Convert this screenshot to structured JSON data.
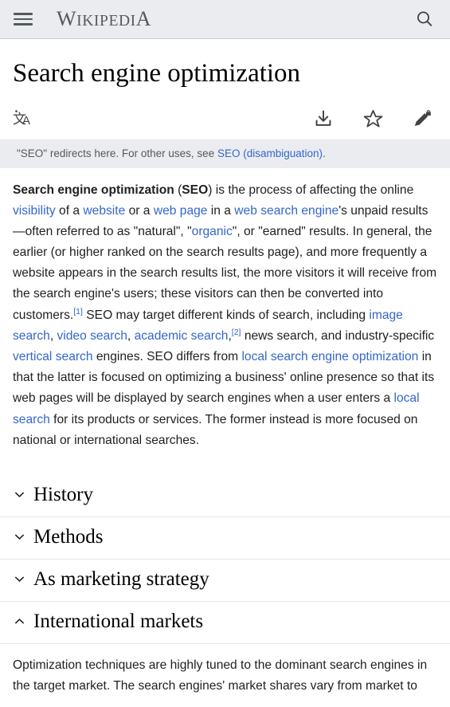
{
  "header": {
    "menu_label": "Menu",
    "wordmark": {
      "w": "W",
      "ikipedi": "IKIPEDI",
      "a": "A",
      "full": "WIKIPEDIA"
    },
    "search_label": "Search"
  },
  "article": {
    "title": "Search engine optimization",
    "hatnote": {
      "prefix": "\"SEO\" redirects here. For other uses, see ",
      "link": "SEO (disambiguation)",
      "suffix": "."
    }
  },
  "actions": {
    "language_icon_cjk": "文",
    "language_icon_latin": "A",
    "language_label": "Change language",
    "download_label": "Download",
    "watch_label": "Watch",
    "edit_label": "Edit protected page"
  },
  "lead": {
    "t1": "Search engine optimization",
    "t2": " (",
    "t3": "SEO",
    "t4": ") is the process of affecting the online ",
    "l1": "visibility",
    "t5": " of a ",
    "l2": "website",
    "t6": " or a ",
    "l3": "web page",
    "t7": " in a ",
    "l4": "web search engine",
    "t8": "'s unpaid results—often referred to as \"natural\", \"",
    "l5": "organic",
    "t9": "\", or \"earned\" results. In general, the earlier (or higher ranked on the search results page), and more frequently a website appears in the search results list, the more visitors it will receive from the search engine's users; these visitors can then be converted into customers.",
    "ref1": "[1]",
    "t10": " SEO may target different kinds of search, including ",
    "l6": "image search",
    "t11": ", ",
    "l7": "video search",
    "t12": ", ",
    "l8": "academic search",
    "t13": ",",
    "ref2": "[2]",
    "t14": " news search, and industry-specific ",
    "l9": "vertical search",
    "t15": " engines. SEO differs from ",
    "l10": "local search engine optimization",
    "t16": " in that the latter is focused on optimizing a business' online presence so that its web pages will be displayed by search engines when a user enters a ",
    "l11": "local search",
    "t17": " for its products or services. The former instead is more focused on national or international searches."
  },
  "sections": [
    {
      "title": "History",
      "expanded": false,
      "chevron": "chevron-down-icon"
    },
    {
      "title": "Methods",
      "expanded": false,
      "chevron": "chevron-down-icon"
    },
    {
      "title": "As marketing strategy",
      "expanded": false,
      "chevron": "chevron-down-icon"
    },
    {
      "title": "International markets",
      "expanded": true,
      "chevron": "chevron-up-icon"
    }
  ],
  "expanded_section_text": "Optimization techniques are highly tuned to the dominant search engines in the target market. The search engines' market shares vary from market to",
  "colors": {
    "header_bg": "#eaecf0",
    "link": "#3366cc",
    "text": "#202122",
    "muted": "#54595d",
    "hatnote_bg": "#eaecf0"
  }
}
